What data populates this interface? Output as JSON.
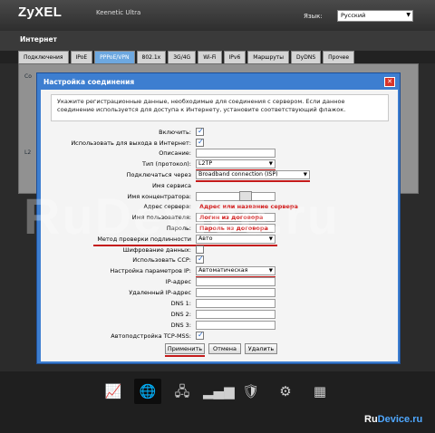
{
  "header": {
    "brand": "ZyXEL",
    "model": "Keenetic Ultra",
    "language_label": "Язык:",
    "language_value": "Русский"
  },
  "section": {
    "title": "Интернет"
  },
  "tabs": [
    "Подключения",
    "IPoE",
    "PPPoE/VPN",
    "802.1x",
    "3G/4G",
    "Wi-Fi",
    "IPv6",
    "Маршруты",
    "DyDNS",
    "Прочее"
  ],
  "background": {
    "col": "Co",
    "frag": "L2"
  },
  "dialog": {
    "title": "Настройка соединения",
    "info": "Укажите регистрационные данные, необходимые для соединения с сервером. Если данное соединение используется для доступа к Интернету, установите соответствующий флажок.",
    "fields": {
      "enable": {
        "label": "Включить:",
        "checked": true
      },
      "use_internet": {
        "label": "Использовать для выхода в Интернет:",
        "checked": true
      },
      "description": {
        "label": "Описание:",
        "value": ""
      },
      "protocol": {
        "label": "Тип (протокол):",
        "value": "L2TP"
      },
      "connect_via": {
        "label": "Подключаться через",
        "value": "Broadband connection (ISP)"
      },
      "service_name": {
        "label": "Имя сервиса"
      },
      "concentrator": {
        "label": "Имя концентратора:"
      },
      "server": {
        "label": "Адрес сервера:",
        "value": "Адрес или название сервера"
      },
      "username": {
        "label": "Имя пользователя:",
        "value": "Логин из договора"
      },
      "password": {
        "label": "Пароль:",
        "value": "Пароль из договора"
      },
      "auth": {
        "label": "Метод проверки подлинности",
        "value": "Авто"
      },
      "encryption": {
        "label": "Шифрование данных:",
        "checked": false
      },
      "ccp": {
        "label": "Использовать CCP:",
        "checked": true
      },
      "ip_settings": {
        "label": "Настройка параметров IP:",
        "value": "Автоматическая"
      },
      "ip": {
        "label": "IP-адрес"
      },
      "remote_ip": {
        "label": "Удаленный IP-адрес"
      },
      "dns1": {
        "label": "DNS 1:"
      },
      "dns2": {
        "label": "DNS 2:"
      },
      "dns3": {
        "label": "DNS 3:"
      },
      "tcp_mss": {
        "label": "Автоподстройка TCP-MSS:",
        "checked": true
      }
    },
    "buttons": {
      "apply": "Применить",
      "cancel": "Отмена",
      "delete": "Удалить"
    }
  },
  "watermark": "RuDevice.ru",
  "credit": {
    "a": "Ru",
    "b": "Device.ru"
  },
  "dock_icons": [
    "chart-icon",
    "internet-globe-icon",
    "network-icon",
    "wifi-signal-icon",
    "security-shield-icon",
    "settings-gear-icon",
    "apps-grid-icon"
  ]
}
